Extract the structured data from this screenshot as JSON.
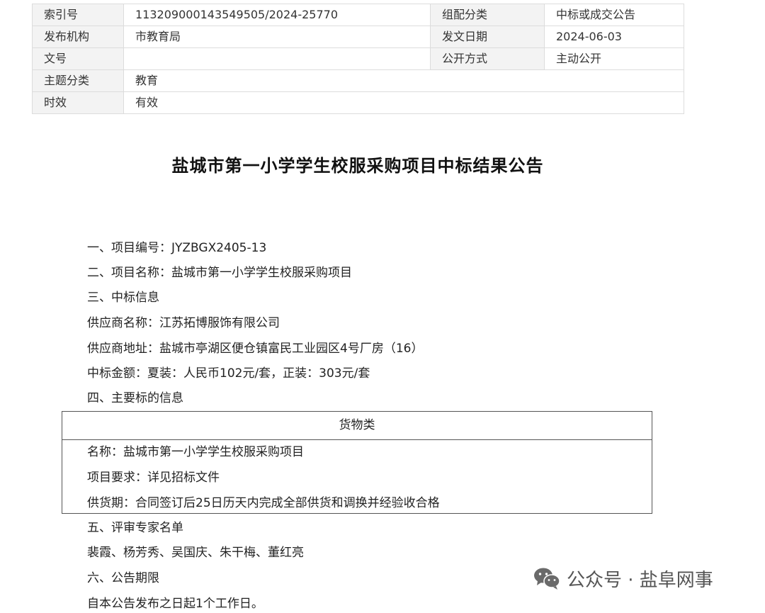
{
  "meta": {
    "rows": [
      {
        "l1": "索引号",
        "v1": "113209000143549505/2024-25770",
        "l2": "组配分类",
        "v2": "中标或成交公告"
      },
      {
        "l1": "发布机构",
        "v1": "市教育局",
        "l2": "发文日期",
        "v2": "2024-06-03"
      },
      {
        "l1": "文号",
        "v1": "",
        "l2": "公开方式",
        "v2": "主动公开"
      },
      {
        "l1": "主题分类",
        "v1": "教育"
      },
      {
        "l1": "时效",
        "v1": "有效"
      }
    ]
  },
  "doc": {
    "title": "盐城市第一小学学生校服采购项目中标结果公告",
    "s1": "一、项目编号：JYZBGX2405-13",
    "s2": "二、项目名称：盐城市第一小学学生校服采购项目",
    "s3": "三、中标信息",
    "supplier_name": "供应商名称：江苏拓博服饰有限公司",
    "supplier_addr": "供应商地址：盐城市亭湖区便仓镇富民工业园区4号厂房（16）",
    "amount": "中标金额：夏装：人民币102元/套，正装：303元/套",
    "s4": "四、主要标的信息",
    "goods": {
      "header": "货物类",
      "name": "名称：盐城市第一小学学生校服采购项目",
      "req": "项目要求：详见招标文件",
      "period": "供货期：合同签订后25日历天内完成全部供货和调换并经验收合格"
    },
    "s5": "五、评审专家名单",
    "experts": "裴霞、杨芳秀、吴国庆、朱干梅、董红亮",
    "s6": "六、公告期限",
    "period_text": "自本公告发布之日起1个工作日。"
  },
  "watermark": {
    "icon": "wechat-icon",
    "text": "公众号 · 盐阜网事"
  }
}
